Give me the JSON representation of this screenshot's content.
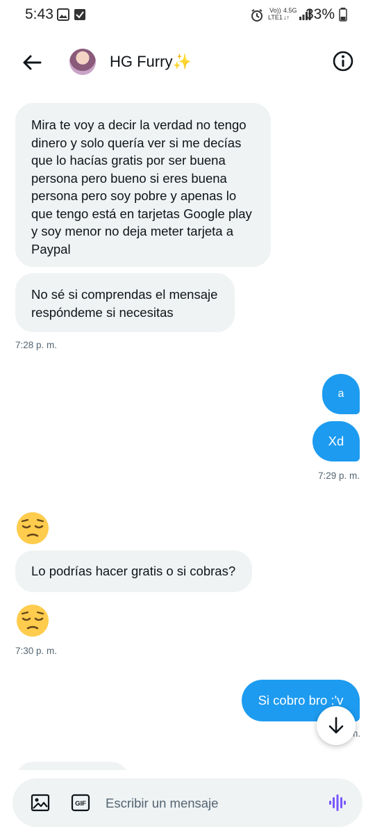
{
  "status_bar": {
    "time": "5:43",
    "network": "LTE1",
    "network_type": "4.5G",
    "battery": "33%"
  },
  "header": {
    "name": "HG Furry",
    "emoji": "✨"
  },
  "messages": {
    "m1": "Mira te voy a decir la verdad no tengo dinero y solo quería ver si me decías que lo hacías gratis por ser buena persona pero bueno si eres buena persona pero soy pobre y apenas lo que tengo está en tarjetas Google play y soy menor no deja meter tarjeta a Paypal",
    "m2": "No sé si comprendas el mensaje respóndeme si necesitas",
    "t1": "7:28 p. m.",
    "o1": "a",
    "o2": "Xd",
    "t2": "7:29 p. m.",
    "e1": "pensive-face",
    "m3": "Lo podrías hacer gratis o si cobras?",
    "e2": "pensive-face",
    "t3": "7:30 p. m.",
    "o3": "Si cobro bro :'v",
    "t4": "m."
  },
  "composer": {
    "placeholder": "Escribir un mensaje"
  },
  "colors": {
    "accent": "#1d9bf0",
    "bubble_in": "#eff3f4",
    "voice": "#7856ff"
  }
}
